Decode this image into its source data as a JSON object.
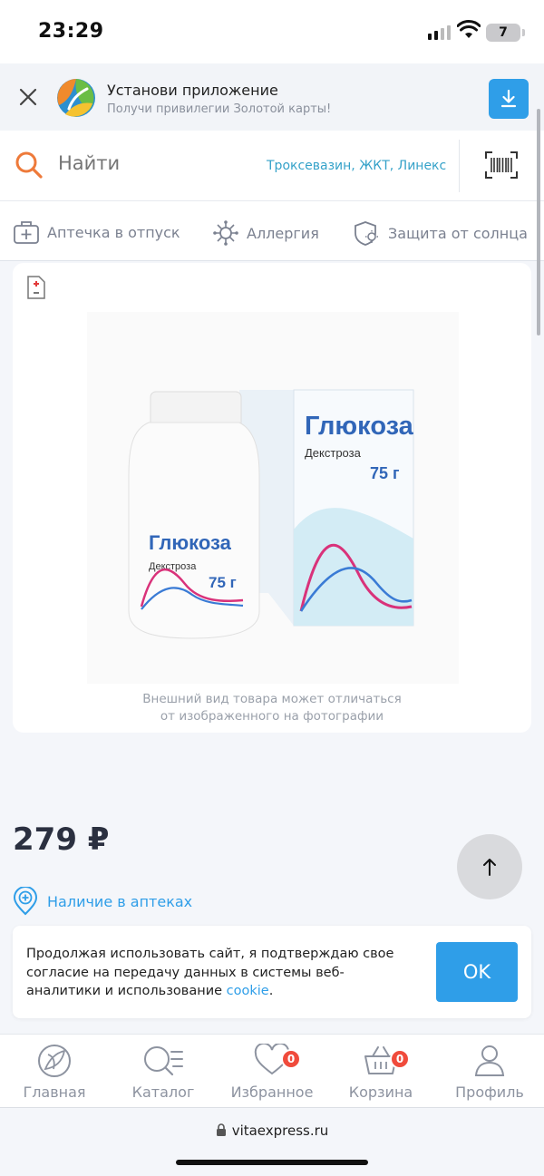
{
  "status_bar": {
    "time": "23:29",
    "battery": "7"
  },
  "app_banner": {
    "title": "Установи приложение",
    "subtitle": "Получи привилегии Золотой карты!"
  },
  "search": {
    "placeholder": "Найти",
    "hints": "Троксевазин, ЖКТ, Линекс"
  },
  "chips": [
    {
      "label": "Аптечка в отпуск",
      "icon": "first-aid-kit-icon"
    },
    {
      "label": "Аллергия",
      "icon": "allergy-icon"
    },
    {
      "label": "Защита от солнца",
      "icon": "sun-shield-icon"
    }
  ],
  "product": {
    "image_text": {
      "name": "Глюкоза",
      "subtitle": "Декстроза",
      "weight": "75 г"
    },
    "disclaimer_line1": "Внешний вид товара может отличаться",
    "disclaimer_line2": "от изображенного на фотографии",
    "price": "279 ₽",
    "availability": "Наличие в аптеках"
  },
  "cookie": {
    "text": "Продолжая использовать сайт, я подтверждаю свое согласие на передачу данных в системы веб-аналитики и использование ",
    "link": "cookie",
    "end": ".",
    "ok": "OK"
  },
  "nav": [
    {
      "label": "Главная",
      "icon": "leaf-logo-icon"
    },
    {
      "label": "Каталог",
      "icon": "catalog-search-icon"
    },
    {
      "label": "Избранное",
      "icon": "heart-icon",
      "badge": "0"
    },
    {
      "label": "Корзина",
      "icon": "basket-icon",
      "badge": "0"
    },
    {
      "label": "Профиль",
      "icon": "profile-icon"
    }
  ],
  "browser": {
    "url": "vitaexpress.ru"
  },
  "colors": {
    "accent": "#2f9ee8",
    "search_icon": "#ee7a3a",
    "badge": "#f04b3c"
  }
}
